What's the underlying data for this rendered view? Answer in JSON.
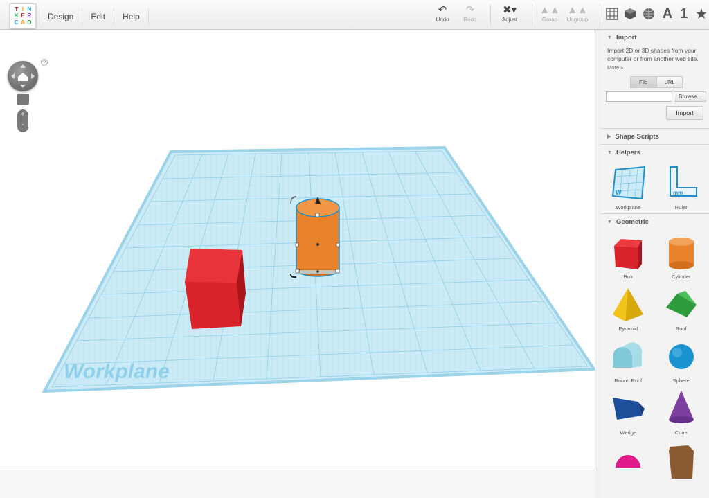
{
  "app": {
    "logo_letters": [
      "T",
      "I",
      "N",
      "K",
      "E",
      "R",
      "C",
      "A",
      "D"
    ]
  },
  "menu": {
    "items": [
      "Design",
      "Edit",
      "Help"
    ]
  },
  "toolbar": {
    "undo": "Undo",
    "redo": "Redo",
    "adjust": "Adjust",
    "group": "Group",
    "ungroup": "Ungroup",
    "category_icons": [
      "grid-icon",
      "cube-icon",
      "globe-icon",
      "text-icon",
      "number-icon",
      "star-icon"
    ],
    "text_label": "A",
    "number_label": "1",
    "star_label": "★"
  },
  "viewport": {
    "help": "?",
    "zoom_in": "+",
    "zoom_out": "-",
    "workplane_label": "Workplane",
    "objects": [
      {
        "name": "Box",
        "color": "#d8232a"
      },
      {
        "name": "Cylinder",
        "color": "#e8832c",
        "selected": true
      }
    ]
  },
  "panel": {
    "import": {
      "title": "Import",
      "description": "Import 2D or 3D shapes from your computer or from another web site.",
      "more": "More »",
      "tabs": [
        "File",
        "URL"
      ],
      "active_tab": "File",
      "file_value": "",
      "browse": "Browse...",
      "button": "Import"
    },
    "shape_scripts": {
      "title": "Shape Scripts"
    },
    "helpers": {
      "title": "Helpers",
      "items": [
        "Workplane",
        "Ruler"
      ]
    },
    "geometric": {
      "title": "Geometric",
      "items": [
        "Box",
        "Cylinder",
        "Pyramid",
        "Roof",
        "Round Roof",
        "Sphere",
        "Wedge",
        "Cone"
      ]
    }
  },
  "colors": {
    "box": "#d8232a",
    "cylinder": "#e8832c",
    "selection": "#1d8fd1",
    "workplane": "#bfe6f3",
    "pyramid": "#f2c318",
    "roof": "#2e9c3c",
    "roundroof": "#7fc9d8",
    "sphere": "#1992d0",
    "wedge": "#1d4e9a",
    "cone": "#7c3ea0",
    "halfsphere": "#e21b8a",
    "polygon": "#8a5a30"
  }
}
